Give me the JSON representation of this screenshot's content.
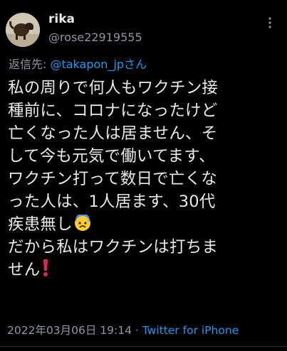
{
  "user": {
    "display_name": "rika",
    "handle": "@rose22919555"
  },
  "reply": {
    "prefix": "返信先: ",
    "mention": "@takapon_jp",
    "suffix": "さん"
  },
  "tweet": {
    "lines": [
      "私の周りで何人もワクチン接",
      "種前に、コロナになったけど",
      "亡くなった人は居ません、そ",
      "して今も元気で働いてます、",
      "ワクチン打って数日で亡くな",
      "った人は、1人居ます、30代",
      "疾患無し",
      "だから私はワクチンは打ちま",
      "せん"
    ],
    "emojis": [
      "anxious-face-with-sweat",
      "red-exclamation-mark"
    ]
  },
  "meta": {
    "datetime": "2022年03月06日 19:14",
    "separator": " · ",
    "source": "Twitter for iPhone"
  },
  "colors": {
    "background": "#000000",
    "text": "#e7e9ea",
    "secondary": "#8b98a5",
    "link": "#1d9bf0",
    "exclamation": "#e0245e"
  }
}
